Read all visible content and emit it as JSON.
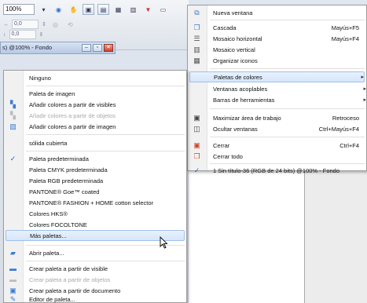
{
  "toolbar": {
    "zoom": "100%",
    "field_x": "0,0",
    "field_y": "0,0",
    "icons": [
      "zoom-dropdown",
      "view-icon",
      "hand-icon",
      "screen-mode-icon",
      "grid-icon",
      "layers-icon"
    ]
  },
  "document": {
    "title": "s) @100% - Fondo"
  },
  "main_menu": {
    "items": [
      {
        "label": "Nueva ventana",
        "shortcut": "",
        "icon": "new-window-icon",
        "has_sub": false
      },
      {
        "label": "Cascada",
        "shortcut": "Mayús+F5",
        "icon": "cascade-icon",
        "has_sub": false
      },
      {
        "label": "Mosaico horizontal",
        "shortcut": "Mayús+F4",
        "icon": "tile-horizontal-icon",
        "has_sub": false
      },
      {
        "label": "Mosaico vertical",
        "shortcut": "",
        "icon": "tile-vertical-icon",
        "has_sub": false
      },
      {
        "label": "Organizar iconos",
        "shortcut": "",
        "icon": "arrange-icons-icon",
        "has_sub": false
      },
      {
        "label": "Paletas de colores",
        "shortcut": "",
        "icon": "",
        "has_sub": true
      },
      {
        "label": "Ventanas acoplables",
        "shortcut": "",
        "icon": "",
        "has_sub": true
      },
      {
        "label": "Barras de herramientas",
        "shortcut": "",
        "icon": "",
        "has_sub": true
      },
      {
        "label": "Maximizar área de trabajo",
        "shortcut": "Retroceso",
        "icon": "maximize-icon",
        "has_sub": false
      },
      {
        "label": "Ocultar ventanas",
        "shortcut": "Ctrl+Mayús+F4",
        "icon": "hide-windows-icon",
        "has_sub": false
      },
      {
        "label": "Cerrar",
        "shortcut": "Ctrl+F4",
        "icon": "close-doc-icon",
        "has_sub": false
      },
      {
        "label": "Cerrar todo",
        "shortcut": "",
        "icon": "close-all-icon",
        "has_sub": false
      },
      {
        "label": "1  Sin título-36 (RGB de 24 bits) @100% - Fondo",
        "shortcut": "",
        "icon": "check-icon",
        "has_sub": false
      }
    ],
    "check_mark": "✓",
    "submenu_arrow": "▸"
  },
  "sub_menu": {
    "items": [
      {
        "label": "Ninguno",
        "disabled": false
      },
      {
        "label": "Paleta de imagen",
        "disabled": false
      },
      {
        "label": "Añadir colores a partir de visibles",
        "disabled": false
      },
      {
        "label": "Añadir colores a partir de objetos",
        "disabled": true
      },
      {
        "label": "Añadir colores a partir de imagen",
        "disabled": false
      },
      {
        "label": "sólida cubierta",
        "disabled": false
      },
      {
        "label": "Paleta predeterminada",
        "disabled": false
      },
      {
        "label": "Paleta CMYK predeterminada",
        "disabled": false
      },
      {
        "label": "Paleta RGB predeterminada",
        "disabled": false
      },
      {
        "label": "PANTONE® Goe™ coated",
        "disabled": false
      },
      {
        "label": "PANTONE® FASHION + HOME cotton selector",
        "disabled": false
      },
      {
        "label": "Colores HKS®",
        "disabled": false
      },
      {
        "label": "Colores FOCOLTONE",
        "disabled": false
      },
      {
        "label": "Más paletas...",
        "disabled": false
      },
      {
        "label": "Abrir paleta...",
        "disabled": false
      },
      {
        "label": "Crear paleta a partir de visible",
        "disabled": false
      },
      {
        "label": "Crear paleta a partir de objetos",
        "disabled": true
      },
      {
        "label": "Crear paleta a partir de documento",
        "disabled": false
      },
      {
        "label": "Editor de paleta...",
        "disabled": false
      }
    ],
    "check_mark": "✓"
  },
  "colors": {
    "highlight": "#d6e6fa",
    "highlight_border": "#9fc0ea",
    "check": "#2a63c5",
    "disabled_text": "#a8a8a8"
  }
}
